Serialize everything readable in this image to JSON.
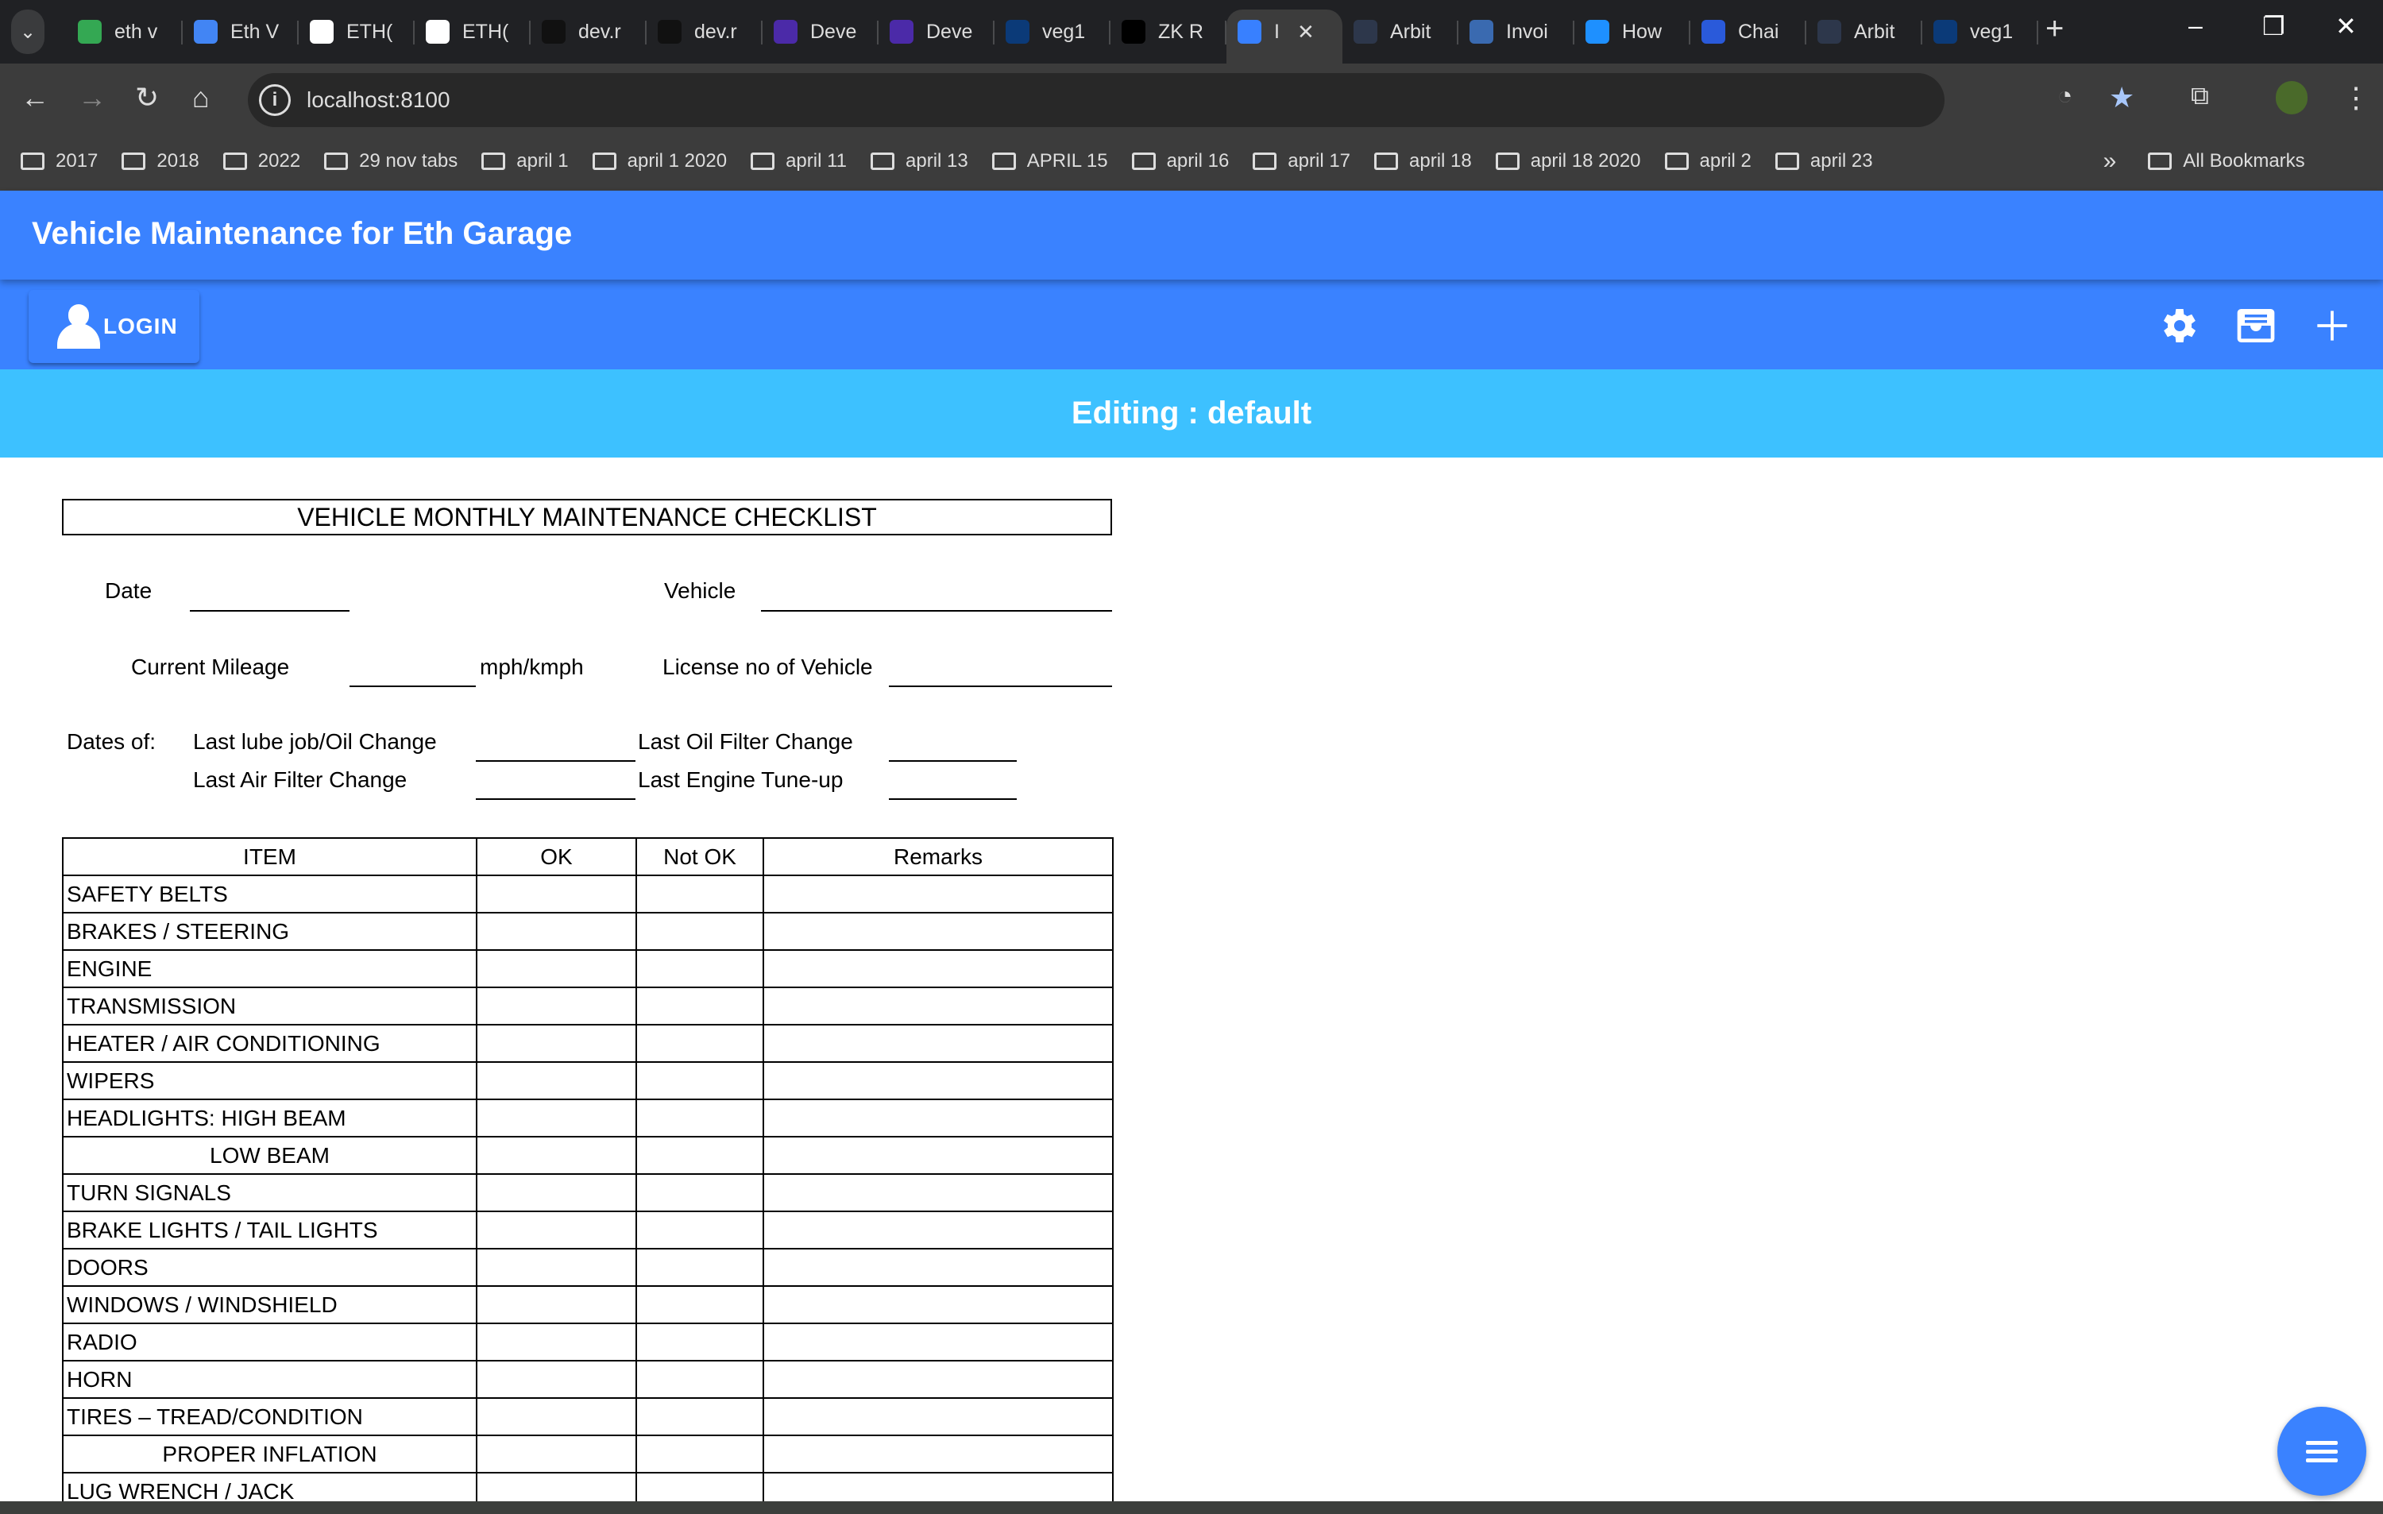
{
  "browser": {
    "tabs": [
      {
        "label": "eth v",
        "icon": "google-drive-icon",
        "color": "#34a853"
      },
      {
        "label": "Eth V",
        "icon": "google-docs-icon",
        "color": "#4285f4"
      },
      {
        "label": "ETH(",
        "icon": "ethglobal-icon",
        "color": "#ffffff"
      },
      {
        "label": "ETH(",
        "icon": "ethglobal-icon",
        "color": "#ffffff"
      },
      {
        "label": "dev.r",
        "icon": "planet-icon",
        "color": "#111111"
      },
      {
        "label": "dev.r",
        "icon": "planet-icon",
        "color": "#111111"
      },
      {
        "label": "Deve",
        "icon": "w-logo-icon",
        "color": "#4b2aa8"
      },
      {
        "label": "Deve",
        "icon": "w-logo-icon",
        "color": "#4b2aa8"
      },
      {
        "label": "veg1",
        "icon": "e-logo-icon",
        "color": "#0b3a78"
      },
      {
        "label": "ZK R",
        "icon": "triangle-logo-icon",
        "color": "#000000"
      },
      {
        "label": "I",
        "icon": "ionic-icon",
        "color": "#3880ff",
        "active": true
      },
      {
        "label": "Arbit",
        "icon": "arbitrum-icon",
        "color": "#2d374b"
      },
      {
        "label": "Invoi",
        "icon": "clipboard-icon",
        "color": "#3a6ab0"
      },
      {
        "label": "How",
        "icon": "d-logo-icon",
        "color": "#1e90ff"
      },
      {
        "label": "Chai",
        "icon": "chainlink-icon",
        "color": "#2a5ada"
      },
      {
        "label": "Arbit",
        "icon": "arbitrum-icon",
        "color": "#2d374b"
      },
      {
        "label": "veg1",
        "icon": "e-logo-icon",
        "color": "#0b3a78"
      }
    ],
    "url": "localhost:8100",
    "bookmarks": [
      "2017",
      "2018",
      "2022",
      "29 nov tabs",
      "april 1",
      "april 1 2020",
      "april 11",
      "april 13",
      "APRIL 15",
      "april 16",
      "april 17",
      "april 18",
      "april 18 2020",
      "april 2",
      "april 23"
    ],
    "all_bookmarks": "All Bookmarks"
  },
  "app": {
    "title": "Vehicle Maintenance for Eth Garage",
    "login_label": "LOGIN",
    "editing": "Editing : default",
    "accent": "#3a82ff",
    "editbar_color": "#3dc1ff"
  },
  "doc": {
    "title": "VEHICLE MONTHLY MAINTENANCE CHECKLIST",
    "date_label": "Date",
    "vehicle_label": "Vehicle",
    "mileage_label": "Current Mileage",
    "mileage_unit": "mph/kmph",
    "license_label": "License no of Vehicle",
    "dates_of": "Dates of:",
    "last_lube": "Last lube job/Oil Change",
    "last_oil_filter": "Last Oil Filter Change",
    "last_air_filter": "Last Air Filter Change",
    "last_tuneup": "Last Engine Tune-up",
    "columns": [
      "ITEM",
      "OK",
      "Not OK",
      "Remarks"
    ],
    "rows": [
      "SAFETY BELTS",
      "BRAKES / STEERING",
      "ENGINE",
      "TRANSMISSION",
      "HEATER / AIR CONDITIONING",
      "WIPERS",
      "HEADLIGHTS:  HIGH BEAM",
      "LOW BEAM",
      "TURN SIGNALS",
      "BRAKE LIGHTS / TAIL LIGHTS",
      "DOORS",
      "WINDOWS / WINDSHIELD",
      "RADIO",
      "HORN",
      "TIRES – TREAD/CONDITION",
      "PROPER INFLATION",
      "LUG WRENCH / JACK"
    ],
    "indented_rows": [
      "LOW BEAM",
      "PROPER INFLATION"
    ]
  }
}
